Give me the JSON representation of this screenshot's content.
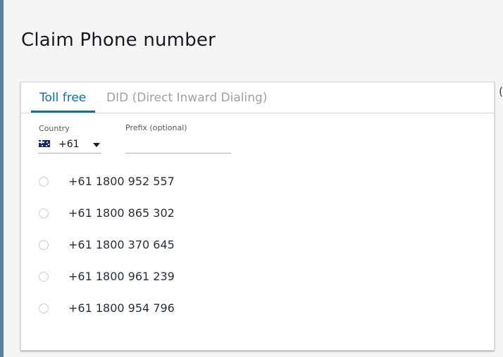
{
  "page": {
    "title": "Claim Phone number"
  },
  "tabs": [
    {
      "label": "Toll free",
      "active": true
    },
    {
      "label": "DID (Direct Inward Dialing)",
      "active": false
    }
  ],
  "form": {
    "country_label": "Country",
    "country_flag": "australia-flag-icon",
    "country_code": "+61",
    "prefix_label": "Prefix (optional)",
    "prefix_value": ""
  },
  "numbers": [
    {
      "number": "+61 1800 952 557",
      "selected": false
    },
    {
      "number": "+61 1800 865 302",
      "selected": false
    },
    {
      "number": "+61 1800 370 645",
      "selected": false
    },
    {
      "number": "+61 1800 961 239",
      "selected": false
    },
    {
      "number": "+61 1800 954 796",
      "selected": false
    }
  ],
  "colors": {
    "accent": "#0073bb",
    "inactive_tab": "#9ba1a5",
    "left_edge": "#5f7ca3"
  }
}
